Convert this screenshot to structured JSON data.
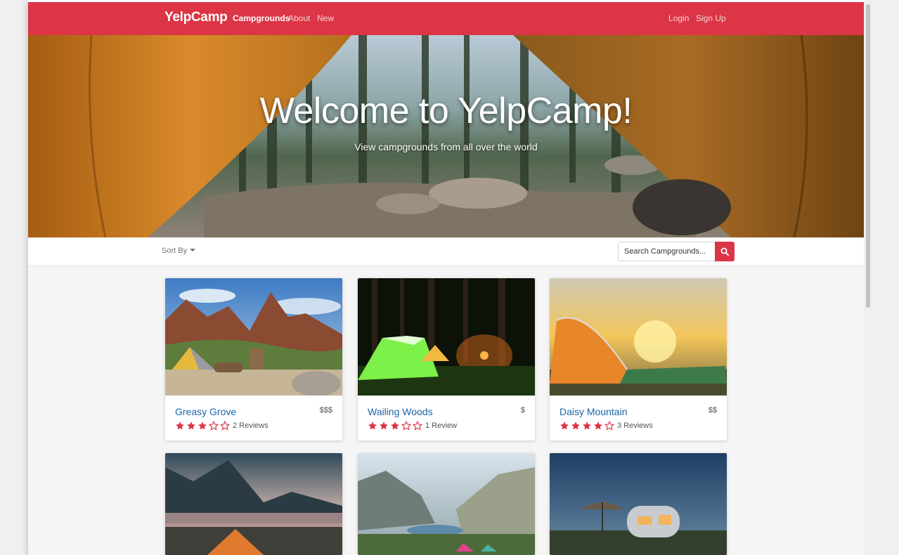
{
  "colors": {
    "brand": "#dc3545",
    "link": "#1a64a8"
  },
  "navbar": {
    "brand": "YelpCamp",
    "links": [
      "Campgrounds",
      "About",
      "New"
    ],
    "auth": [
      "Login",
      "Sign Up"
    ]
  },
  "hero": {
    "title": "Welcome to YelpCamp!",
    "subtitle": "View campgrounds from all over the world"
  },
  "filter": {
    "sort_label": "Sort By",
    "search_placeholder": "Search Campgrounds...",
    "search_icon": "search-icon"
  },
  "campgrounds": [
    {
      "name": "Greasy Grove",
      "price": "$$$",
      "rating": 3,
      "reviews": "2 Reviews"
    },
    {
      "name": "Wailing Woods",
      "price": "$",
      "rating": 3,
      "reviews": "1 Review"
    },
    {
      "name": "Daisy Mountain",
      "price": "$$",
      "rating": 4,
      "reviews": "3 Reviews"
    },
    {
      "name": "",
      "price": "",
      "rating": null,
      "reviews": ""
    },
    {
      "name": "",
      "price": "",
      "rating": null,
      "reviews": ""
    },
    {
      "name": "",
      "price": "",
      "rating": null,
      "reviews": ""
    }
  ]
}
